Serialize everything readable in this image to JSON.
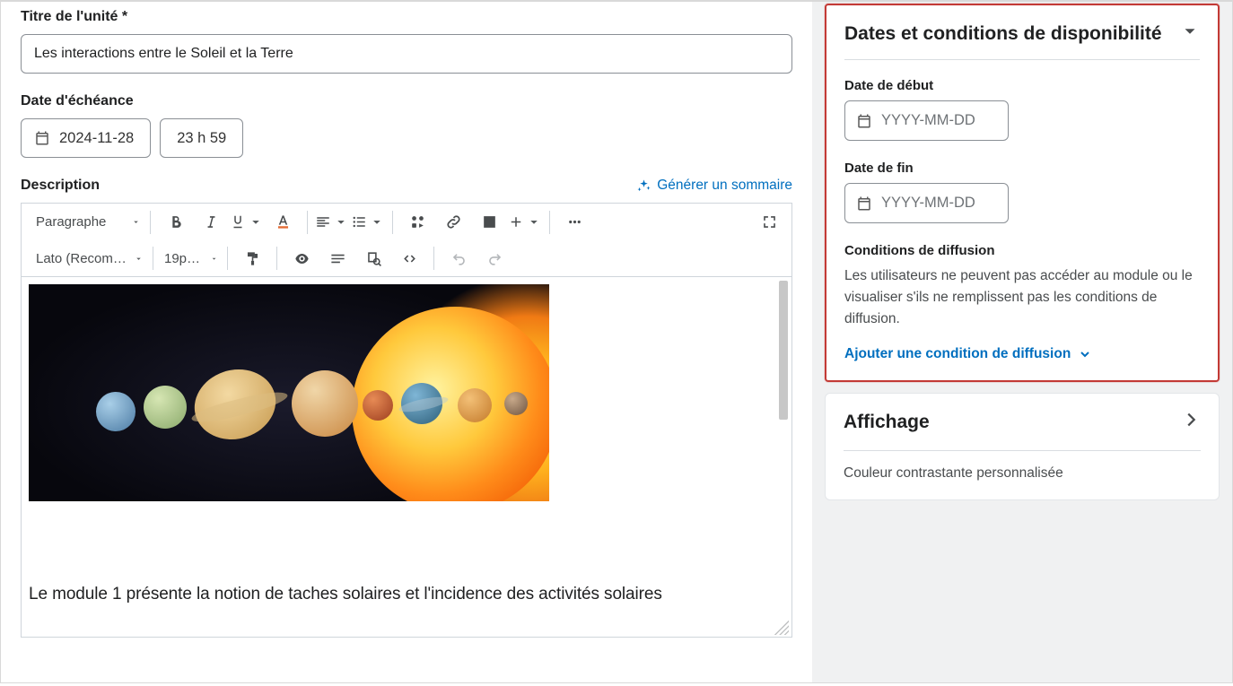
{
  "main": {
    "title_label": "Titre de l'unité *",
    "title_value": "Les interactions entre le Soleil et la Terre",
    "due_label": "Date d'échéance",
    "due_date": "2024-11-28",
    "due_time": "23 h 59",
    "description_label": "Description",
    "generate_summary": "Générer un sommaire",
    "body_paragraph": "Le module 1 présente la notion de taches solaires et l'incidence des activités solaires"
  },
  "toolbar": {
    "paragraph_label": "Paragraphe",
    "font_label": "Lato (Recom…",
    "size_label": "19px …"
  },
  "sidebar": {
    "availability": {
      "title": "Dates et conditions de disponibilité",
      "start_label": "Date de début",
      "start_placeholder": "YYYY-MM-DD",
      "end_label": "Date de fin",
      "end_placeholder": "YYYY-MM-DD",
      "conditions_heading": "Conditions de diffusion",
      "conditions_body": "Les utilisateurs ne peuvent pas accéder au module ou le visualiser s'ils ne remplissent pas les conditions de diffusion.",
      "add_condition": "Ajouter une condition de diffusion"
    },
    "display": {
      "title": "Affichage",
      "contrast_color": "Couleur contrastante personnalisée"
    }
  }
}
